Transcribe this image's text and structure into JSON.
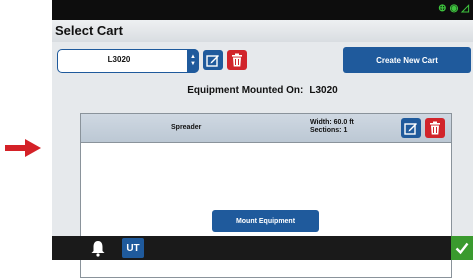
{
  "header": {
    "status_icons": [
      "gps-icon",
      "signal-icon",
      "wifi-off-icon"
    ],
    "status_color": "#3ec43e",
    "title": "Select Cart"
  },
  "cart_selector": {
    "selected": "L3020",
    "edit_icon": "edit-icon",
    "delete_icon": "trash-icon",
    "create_label": "Create New Cart"
  },
  "mounted": {
    "label": "Equipment Mounted On:",
    "value": "L3020"
  },
  "equipment": {
    "name": "Spreader",
    "width": "Width: 60.0 ft",
    "sections": "Sections: 1",
    "mount_label": "Mount Equipment"
  },
  "footer": {
    "bell_icon": "bell-icon",
    "ut_label": "UT",
    "confirm_icon": "check-icon"
  },
  "colors": {
    "accent_blue": "#1f5a9c",
    "delete_red": "#d1242b",
    "confirm_green": "#3a9a2e",
    "pointer_arrow": "#d42127"
  }
}
